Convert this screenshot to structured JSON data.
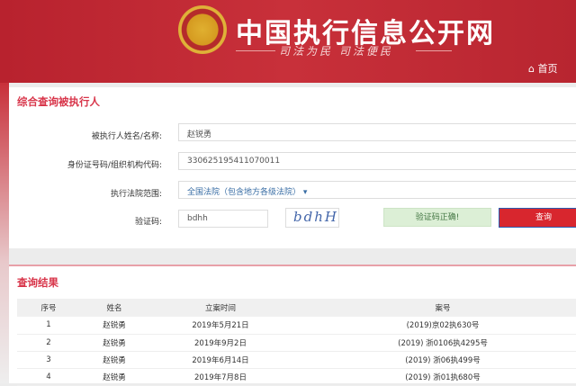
{
  "header": {
    "title": "中国执行信息公开网",
    "slogan": "司法为民  司法便民",
    "home": "首页",
    "emblem_text": "法院徽章"
  },
  "query": {
    "title": "综合查询被执行人",
    "name_label": "被执行人姓名/名称:",
    "name_value": "赵锐勇",
    "id_label": "身份证号码/组织机构代码:",
    "id_value": "330625195411070011",
    "court_label": "执行法院范围:",
    "court_value": "全国法院（包含地方各级法院）",
    "captcha_label": "验证码:",
    "captcha_value": "bdhh",
    "captcha_image": "bdhH",
    "captcha_status": "验证码正确!",
    "search_button": "查询"
  },
  "results": {
    "title": "查询结果",
    "columns": [
      "序号",
      "姓名",
      "立案时间",
      "案号"
    ],
    "rows": [
      [
        "1",
        "赵锐勇",
        "2019年5月21日",
        "(2019)京02执630号"
      ],
      [
        "2",
        "赵锐勇",
        "2019年9月2日",
        "(2019) 浙0106执4295号"
      ],
      [
        "3",
        "赵锐勇",
        "2019年6月14日",
        "(2019) 浙06执499号"
      ],
      [
        "4",
        "赵锐勇",
        "2019年7月8日",
        "(2019) 浙01执680号"
      ]
    ]
  }
}
